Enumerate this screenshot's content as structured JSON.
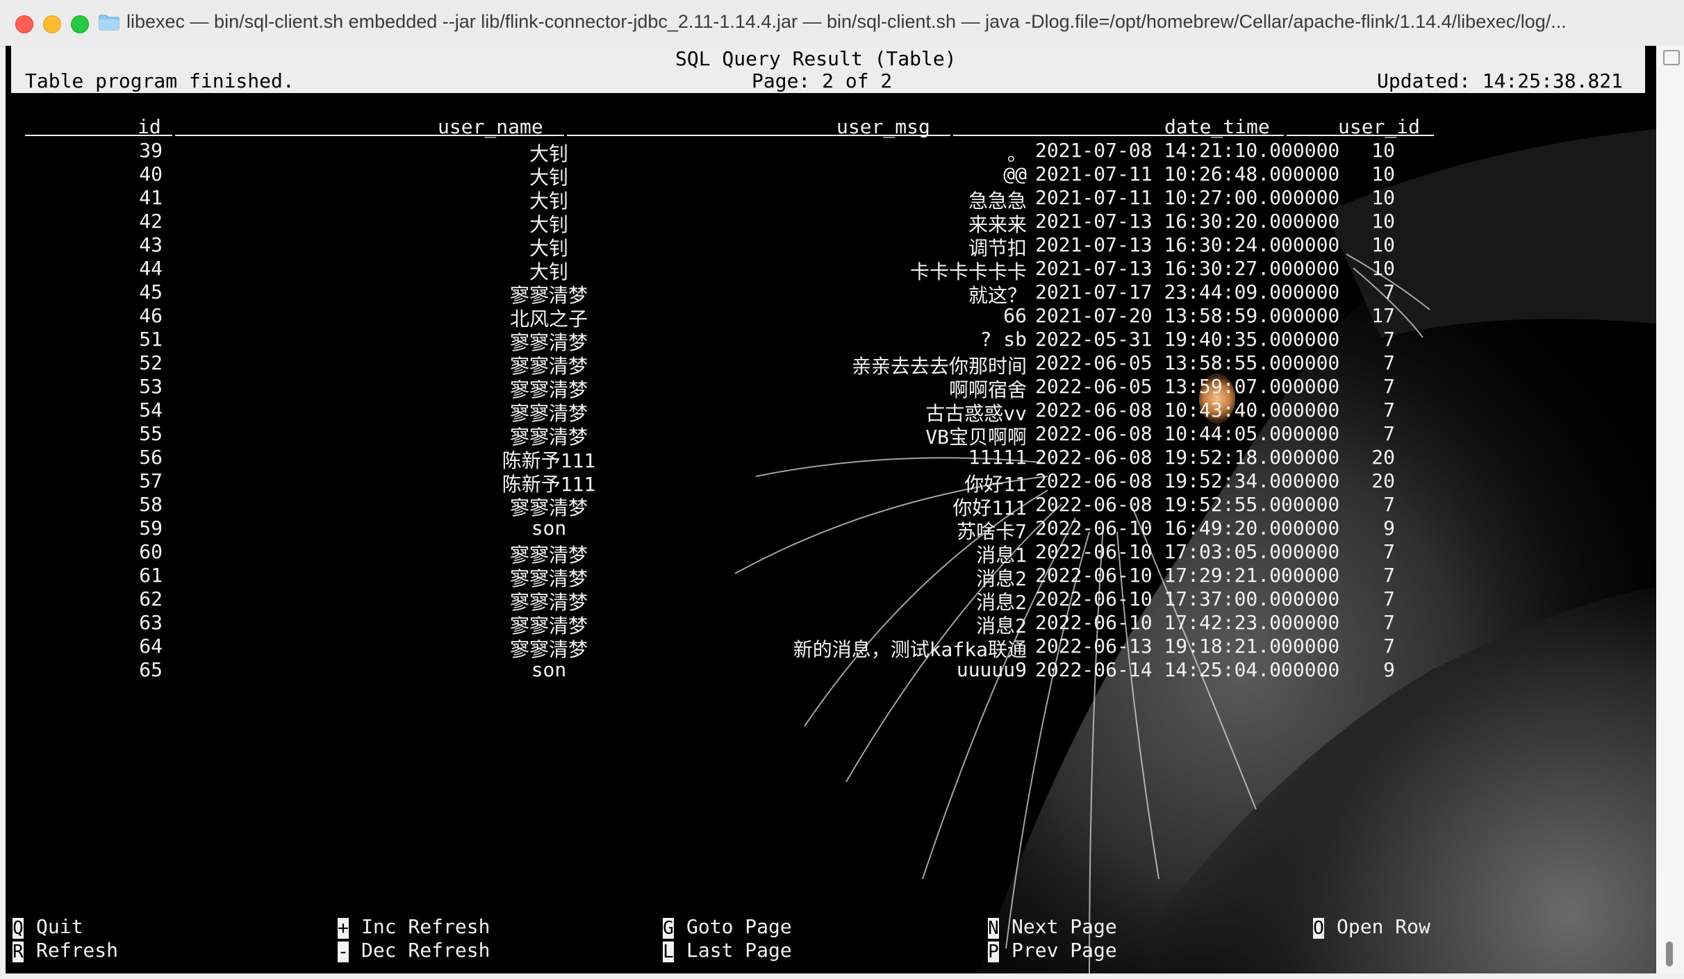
{
  "window": {
    "title": "libexec — bin/sql-client.sh embedded --jar lib/flink-connector-jdbc_2.11-1.14.4.jar   — bin/sql-client.sh — java -Dlog.file=/opt/homebrew/Cellar/apache-flink/1.14.4/libexec/log/..."
  },
  "header": {
    "title": "SQL Query Result (Table)",
    "status": "Table program finished.",
    "page": "Page: 2 of 2",
    "updated": "Updated: 14:25:38.821"
  },
  "table": {
    "columns": [
      "id",
      "user_name",
      "user_msg",
      "date_time",
      "user_id"
    ],
    "rows": [
      {
        "id": "39",
        "user_name": "大钊",
        "user_msg": "。",
        "date_time": "2021-07-08 14:21:10.000000",
        "user_id": "10"
      },
      {
        "id": "40",
        "user_name": "大钊",
        "user_msg": "@@",
        "date_time": "2021-07-11 10:26:48.000000",
        "user_id": "10"
      },
      {
        "id": "41",
        "user_name": "大钊",
        "user_msg": "急急急",
        "date_time": "2021-07-11 10:27:00.000000",
        "user_id": "10"
      },
      {
        "id": "42",
        "user_name": "大钊",
        "user_msg": "来来来",
        "date_time": "2021-07-13 16:30:20.000000",
        "user_id": "10"
      },
      {
        "id": "43",
        "user_name": "大钊",
        "user_msg": "调节扣",
        "date_time": "2021-07-13 16:30:24.000000",
        "user_id": "10"
      },
      {
        "id": "44",
        "user_name": "大钊",
        "user_msg": "卡卡卡卡卡卡",
        "date_time": "2021-07-13 16:30:27.000000",
        "user_id": "10"
      },
      {
        "id": "45",
        "user_name": "寥寥清梦",
        "user_msg": "就这？",
        "date_time": "2021-07-17 23:44:09.000000",
        "user_id": "7"
      },
      {
        "id": "46",
        "user_name": "北风之子",
        "user_msg": "66",
        "date_time": "2021-07-20 13:58:59.000000",
        "user_id": "17"
      },
      {
        "id": "51",
        "user_name": "寥寥清梦",
        "user_msg": "? sb",
        "date_time": "2022-05-31 19:40:35.000000",
        "user_id": "7"
      },
      {
        "id": "52",
        "user_name": "寥寥清梦",
        "user_msg": "亲亲去去去你那时间",
        "date_time": "2022-06-05 13:58:55.000000",
        "user_id": "7"
      },
      {
        "id": "53",
        "user_name": "寥寥清梦",
        "user_msg": "啊啊宿舍",
        "date_time": "2022-06-05 13:59:07.000000",
        "user_id": "7"
      },
      {
        "id": "54",
        "user_name": "寥寥清梦",
        "user_msg": "古古惑惑vv",
        "date_time": "2022-06-08 10:43:40.000000",
        "user_id": "7"
      },
      {
        "id": "55",
        "user_name": "寥寥清梦",
        "user_msg": "VB宝贝啊啊",
        "date_time": "2022-06-08 10:44:05.000000",
        "user_id": "7"
      },
      {
        "id": "56",
        "user_name": "陈新予111",
        "user_msg": "11111",
        "date_time": "2022-06-08 19:52:18.000000",
        "user_id": "20"
      },
      {
        "id": "57",
        "user_name": "陈新予111",
        "user_msg": "你好11",
        "date_time": "2022-06-08 19:52:34.000000",
        "user_id": "20"
      },
      {
        "id": "58",
        "user_name": "寥寥清梦",
        "user_msg": "你好111",
        "date_time": "2022-06-08 19:52:55.000000",
        "user_id": "7"
      },
      {
        "id": "59",
        "user_name": "son",
        "user_msg": "苏啥卡7",
        "date_time": "2022-06-10 16:49:20.000000",
        "user_id": "9"
      },
      {
        "id": "60",
        "user_name": "寥寥清梦",
        "user_msg": "消息1",
        "date_time": "2022-06-10 17:03:05.000000",
        "user_id": "7"
      },
      {
        "id": "61",
        "user_name": "寥寥清梦",
        "user_msg": "消息2",
        "date_time": "2022-06-10 17:29:21.000000",
        "user_id": "7"
      },
      {
        "id": "62",
        "user_name": "寥寥清梦",
        "user_msg": "消息2",
        "date_time": "2022-06-10 17:37:00.000000",
        "user_id": "7"
      },
      {
        "id": "63",
        "user_name": "寥寥清梦",
        "user_msg": "消息2",
        "date_time": "2022-06-10 17:42:23.000000",
        "user_id": "7"
      },
      {
        "id": "64",
        "user_name": "寥寥清梦",
        "user_msg": "新的消息，测试kafka联通",
        "date_time": "2022-06-13 19:18:21.000000",
        "user_id": "7"
      },
      {
        "id": "65",
        "user_name": "son",
        "user_msg": "uuuuu9",
        "date_time": "2022-06-14 14:25:04.000000",
        "user_id": "9"
      }
    ]
  },
  "footer": {
    "keys": [
      {
        "key": "Q",
        "label": "Quit"
      },
      {
        "key": "R",
        "label": "Refresh"
      },
      {
        "key": "+",
        "label": "Inc Refresh"
      },
      {
        "key": "-",
        "label": "Dec Refresh"
      },
      {
        "key": "G",
        "label": "Goto Page"
      },
      {
        "key": "L",
        "label": "Last Page"
      },
      {
        "key": "N",
        "label": "Next Page"
      },
      {
        "key": "P",
        "label": "Prev Page"
      },
      {
        "key": "O",
        "label": "Open Row"
      }
    ]
  },
  "icons": {
    "close": "close-icon",
    "minimize": "minimize-icon",
    "zoom": "zoom-icon",
    "folder": "folder-icon"
  },
  "colors": {
    "terminal_bg": "#000000",
    "terminal_fg": "#f2f2f2",
    "header_bg": "#ededed",
    "close": "#ff5f57",
    "minimize": "#febc2e",
    "zoom": "#28c840"
  }
}
